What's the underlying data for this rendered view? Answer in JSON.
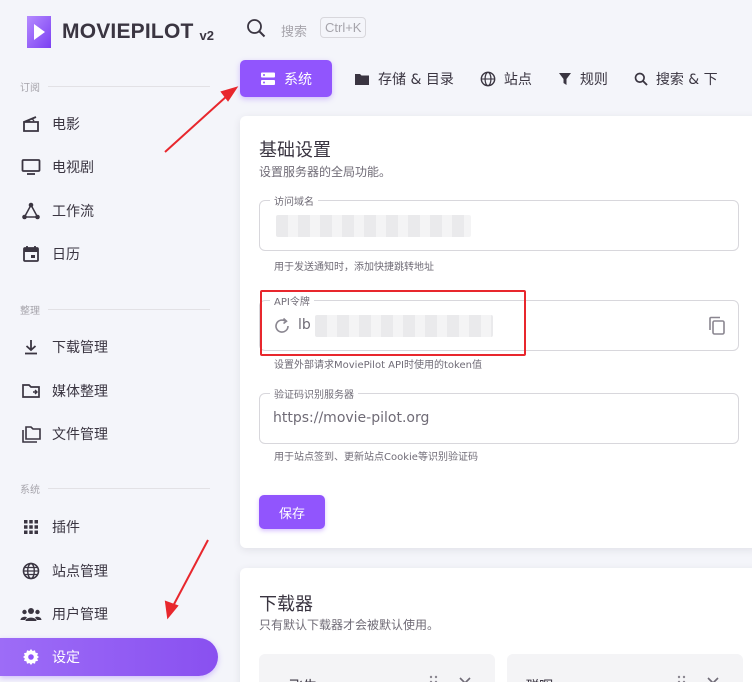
{
  "brand": {
    "name": "MOVIEPILOT",
    "version": "v2"
  },
  "sidebar": {
    "sections": [
      {
        "label": "订阅",
        "items": [
          {
            "label": "电影",
            "icon": "movie-icon"
          },
          {
            "label": "电视剧",
            "icon": "tv-icon"
          },
          {
            "label": "工作流",
            "icon": "workflow-icon"
          },
          {
            "label": "日历",
            "icon": "calendar-icon"
          }
        ]
      },
      {
        "label": "整理",
        "items": [
          {
            "label": "下载管理",
            "icon": "download-icon"
          },
          {
            "label": "媒体整理",
            "icon": "media-organize-icon"
          },
          {
            "label": "文件管理",
            "icon": "file-manager-icon"
          }
        ]
      },
      {
        "label": "系统",
        "items": [
          {
            "label": "插件",
            "icon": "plugins-grid-icon"
          },
          {
            "label": "站点管理",
            "icon": "globe-icon"
          },
          {
            "label": "用户管理",
            "icon": "users-icon"
          },
          {
            "label": "设定",
            "icon": "gear-icon",
            "active": true
          }
        ]
      }
    ]
  },
  "topbar": {
    "search_label": "搜索",
    "shortcut": "Ctrl+K"
  },
  "tabs": [
    {
      "label": "系统",
      "icon": "server-icon",
      "active": true
    },
    {
      "label": "存储 & 目录",
      "icon": "folder-icon"
    },
    {
      "label": "站点",
      "icon": "globe-icon"
    },
    {
      "label": "规则",
      "icon": "filter-icon"
    },
    {
      "label": "搜索 & 下",
      "icon": "search-icon"
    }
  ],
  "basic": {
    "title": "基础设置",
    "subtitle": "设置服务器的全局功能。",
    "fields": [
      {
        "label": "访问域名",
        "value": "",
        "hint": "用于发送通知时，添加快捷跳转地址"
      },
      {
        "label": "API令牌",
        "value": "lb",
        "hint": "设置外部请求MoviePilot API时使用的token值"
      },
      {
        "label": "验证码识别服务器",
        "value": "https://movie-pilot.org",
        "hint": "用于站点签到、更新站点Cookie等识别验证码"
      }
    ],
    "save_label": "保存"
  },
  "downloader": {
    "title": "下载器",
    "subtitle": "只有默认下载器才会被默认使用。",
    "cards": [
      {
        "title": "飞牛"
      },
      {
        "title": "群晖"
      }
    ]
  },
  "colors": {
    "accent": "#9155fd",
    "annotation": "#e8272d"
  }
}
